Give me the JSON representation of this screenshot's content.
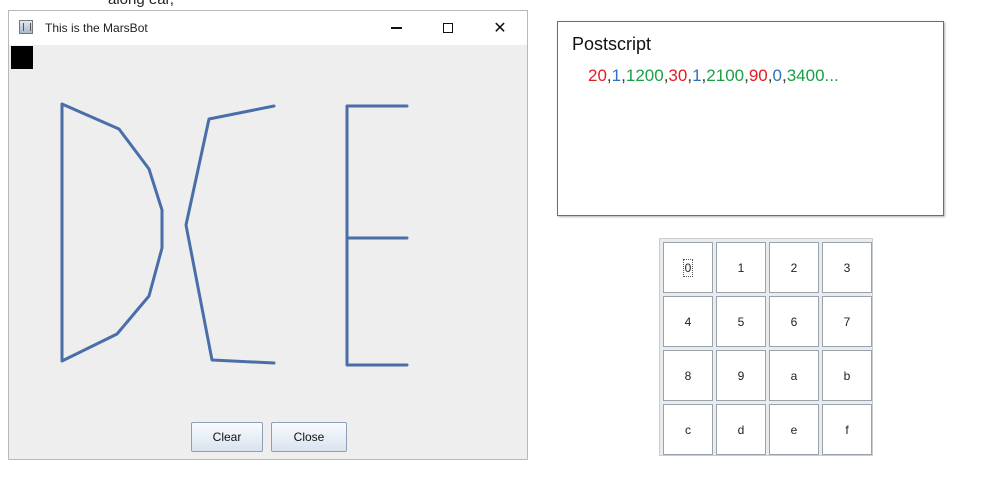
{
  "top_cut_text": "along ear,",
  "window": {
    "title": "This is the MarsBot",
    "controls": {
      "minimize_icon": "minimize-icon",
      "maximize_icon": "maximize-icon",
      "close_icon": "close-icon"
    },
    "buttons": {
      "clear": "Clear",
      "close": "Close"
    }
  },
  "postscript": {
    "title": "Postscript",
    "sequence": [
      {
        "text": "20",
        "color": "red"
      },
      {
        "text": ",",
        "color": "comma"
      },
      {
        "text": "1",
        "color": "blue"
      },
      {
        "text": ",",
        "color": "comma"
      },
      {
        "text": "1200",
        "color": "green"
      },
      {
        "text": ",",
        "color": "comma"
      },
      {
        "text": "30",
        "color": "red"
      },
      {
        "text": ",",
        "color": "comma"
      },
      {
        "text": "1",
        "color": "blue"
      },
      {
        "text": ",",
        "color": "comma"
      },
      {
        "text": "2100",
        "color": "green"
      },
      {
        "text": ",",
        "color": "comma"
      },
      {
        "text": "90",
        "color": "red"
      },
      {
        "text": ",",
        "color": "comma"
      },
      {
        "text": "0",
        "color": "blue"
      },
      {
        "text": ",",
        "color": "comma"
      },
      {
        "text": "3400...",
        "color": "green"
      }
    ],
    "colors": {
      "red": "#e01d23",
      "blue": "#2f6fc4",
      "green": "#19a043"
    }
  },
  "keypad": {
    "keys": [
      "0",
      "1",
      "2",
      "3",
      "4",
      "5",
      "6",
      "7",
      "8",
      "9",
      "a",
      "b",
      "c",
      "d",
      "e",
      "f"
    ],
    "focused": "0"
  },
  "drawing": {
    "stroke_color": "#4a6ea8"
  }
}
